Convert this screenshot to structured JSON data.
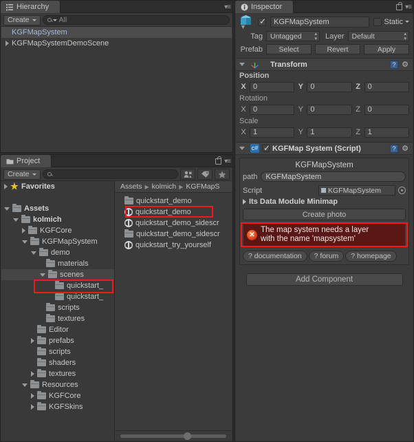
{
  "hierarchy": {
    "tab_label": "Hierarchy",
    "tab_icon": "hierarchy-icon",
    "create_label": "Create",
    "search_placeholder": "All",
    "items": [
      {
        "label": "KGFMapSystem",
        "selected": true,
        "expandable": false
      },
      {
        "label": "KGFMapSystemDemoScene",
        "selected": false,
        "expandable": true
      }
    ]
  },
  "project": {
    "tab_label": "Project",
    "create_label": "Create",
    "search_placeholder": "",
    "favorites_label": "Favorites",
    "breadcrumb": [
      "Assets",
      "kolmich",
      "KGFMapS"
    ],
    "tree": [
      {
        "label": "Favorites",
        "depth": 0,
        "icon": "star-icon",
        "arrow": "right",
        "bold": true
      },
      {
        "label": "",
        "depth": 0,
        "icon": "none",
        "arrow": "none",
        "bold": false
      },
      {
        "label": "Assets",
        "depth": 0,
        "icon": "folder-icon",
        "arrow": "down",
        "bold": true
      },
      {
        "label": "kolmich",
        "depth": 1,
        "icon": "folder-icon",
        "arrow": "down",
        "bold": true
      },
      {
        "label": "KGFCore",
        "depth": 2,
        "icon": "folder-icon",
        "arrow": "right",
        "bold": false
      },
      {
        "label": "KGFMapSystem",
        "depth": 2,
        "icon": "folder-icon",
        "arrow": "down",
        "bold": false
      },
      {
        "label": "demo",
        "depth": 3,
        "icon": "folder-icon",
        "arrow": "down",
        "bold": false
      },
      {
        "label": "materials",
        "depth": 4,
        "icon": "folder-icon",
        "arrow": "none",
        "bold": false
      },
      {
        "label": "scenes",
        "depth": 4,
        "icon": "folder-icon",
        "arrow": "down",
        "bold": false,
        "highlighted": true
      },
      {
        "label": "quickstart_",
        "depth": 5,
        "icon": "folder-icon",
        "arrow": "none",
        "bold": false
      },
      {
        "label": "quickstart_",
        "depth": 5,
        "icon": "folder-icon",
        "arrow": "none",
        "bold": false
      },
      {
        "label": "scripts",
        "depth": 4,
        "icon": "folder-icon",
        "arrow": "none",
        "bold": false
      },
      {
        "label": "textures",
        "depth": 4,
        "icon": "folder-icon",
        "arrow": "none",
        "bold": false
      },
      {
        "label": "Editor",
        "depth": 3,
        "icon": "folder-icon",
        "arrow": "none",
        "bold": false
      },
      {
        "label": "prefabs",
        "depth": 3,
        "icon": "folder-icon",
        "arrow": "right",
        "bold": false
      },
      {
        "label": "scripts",
        "depth": 3,
        "icon": "folder-icon",
        "arrow": "none",
        "bold": false
      },
      {
        "label": "shaders",
        "depth": 3,
        "icon": "folder-icon",
        "arrow": "none",
        "bold": false
      },
      {
        "label": "textures",
        "depth": 3,
        "icon": "folder-icon",
        "arrow": "right",
        "bold": false
      },
      {
        "label": "Resources",
        "depth": 2,
        "icon": "folder-icon",
        "arrow": "down",
        "bold": false
      },
      {
        "label": "KGFCore",
        "depth": 3,
        "icon": "folder-icon",
        "arrow": "right",
        "bold": false
      },
      {
        "label": "KGFSkins",
        "depth": 3,
        "icon": "folder-icon",
        "arrow": "right",
        "bold": false
      }
    ],
    "assets": [
      {
        "label": "quickstart_demo",
        "icon": "folder-icon",
        "highlighted": false
      },
      {
        "label": "quickstart_demo",
        "icon": "unity-scene-icon",
        "highlighted": true
      },
      {
        "label": "quickstart_demo_sidescr",
        "icon": "unity-scene-icon",
        "highlighted": false
      },
      {
        "label": "quickstart_demo_sidescr",
        "icon": "folder-icon",
        "highlighted": false
      },
      {
        "label": "quickstart_try_yourself",
        "icon": "unity-scene-icon",
        "highlighted": false
      }
    ]
  },
  "inspector": {
    "tab_label": "Inspector",
    "tab_icon": "info-icon",
    "lock_icon": "lock-icon",
    "object_name": "KGFMapSystem",
    "object_enabled": true,
    "static_label": "Static",
    "static_checked": false,
    "tag_label": "Tag",
    "tag_value": "Untagged",
    "layer_label": "Layer",
    "layer_value": "Default",
    "prefab_label": "Prefab",
    "prefab_buttons": [
      "Select",
      "Revert",
      "Apply"
    ],
    "transform": {
      "title": "Transform",
      "icon": "transform-axis-icon",
      "help_icon": "help-icon",
      "gear_icon": "gear-icon",
      "groups": [
        {
          "name": "Position",
          "bold": true,
          "fields": [
            {
              "axis": "X",
              "value": "0"
            },
            {
              "axis": "Y",
              "value": "0"
            },
            {
              "axis": "Z",
              "value": "0"
            }
          ]
        },
        {
          "name": "Rotation",
          "bold": false,
          "fields": [
            {
              "axis": "X",
              "value": "0"
            },
            {
              "axis": "Y",
              "value": "0"
            },
            {
              "axis": "Z",
              "value": "0"
            }
          ]
        },
        {
          "name": "Scale",
          "bold": false,
          "fields": [
            {
              "axis": "X",
              "value": "1"
            },
            {
              "axis": "Y",
              "value": "1"
            },
            {
              "axis": "Z",
              "value": "1"
            }
          ]
        }
      ]
    },
    "script_component": {
      "title": "KGFMap System (Script)",
      "enabled": true,
      "icon": "csharp-script-icon",
      "help_icon": "help-icon",
      "gear_icon": "gear-icon",
      "box_title": "KGFMapSystem",
      "path_label": "path",
      "path_value": "KGFMapSystem",
      "script_label": "Script",
      "script_value": "KGFMapSystem",
      "picker_icon": "object-picker-icon",
      "data_module_label": "Its Data Module Minimap",
      "create_photo_label": "Create photo",
      "error_icon": "error-icon",
      "error_text_line1": "The map system needs a layer",
      "error_text_line2": "with the name 'mapsystem'",
      "links": [
        "? documentation",
        "? forum",
        "? homepage"
      ]
    },
    "add_component_label": "Add Component"
  },
  "colors": {
    "panel_bg": "#383838",
    "selection": "#4c4c4c",
    "selection_text": "#a9b7dd",
    "annotation_red": "#ef1b1b",
    "error_bg": "#5a1715",
    "accent_blue": "#3b5f8f"
  }
}
